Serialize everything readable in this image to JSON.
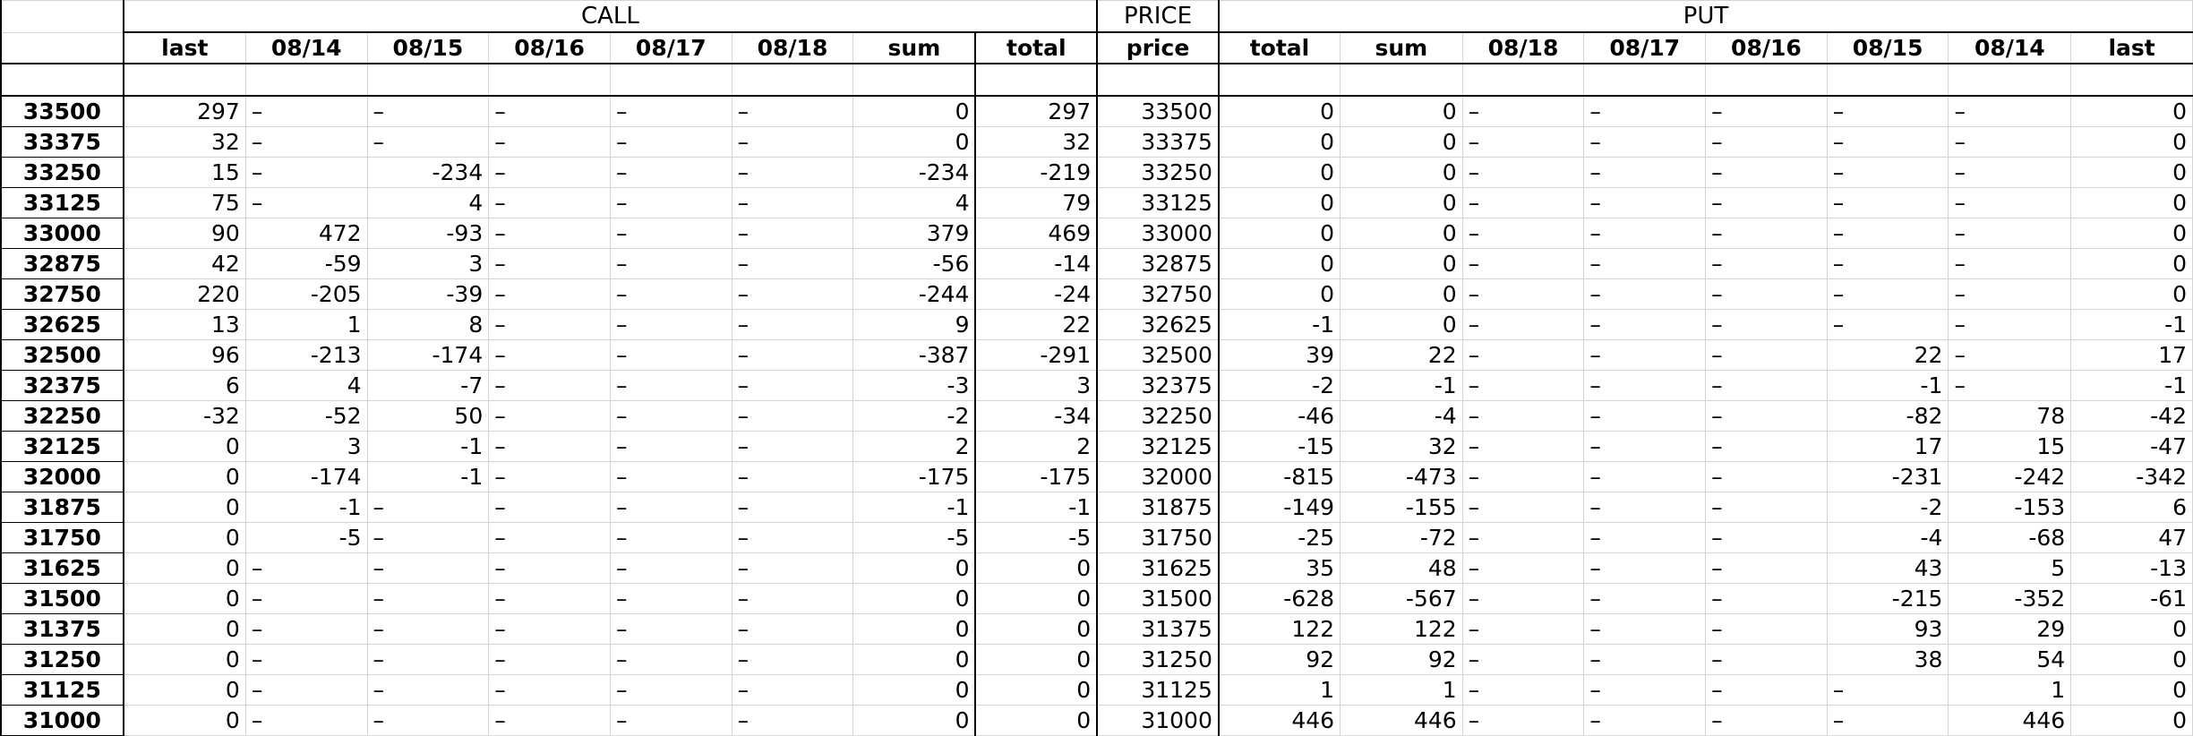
{
  "groups": {
    "call": "CALL",
    "price": "PRICE",
    "put": "PUT"
  },
  "headers": [
    "last",
    "08/14",
    "08/15",
    "08/16",
    "08/17",
    "08/18",
    "sum",
    "total",
    "price",
    "total",
    "sum",
    "08/18",
    "08/17",
    "08/16",
    "08/15",
    "08/14",
    "last"
  ],
  "rows": [
    {
      "label": "33500",
      "cells": [
        "297",
        "–",
        "–",
        "–",
        "–",
        "–",
        "0",
        "297",
        "33500",
        "0",
        "0",
        "–",
        "–",
        "–",
        "–",
        "–",
        "0"
      ]
    },
    {
      "label": "33375",
      "cells": [
        "32",
        "–",
        "–",
        "–",
        "–",
        "–",
        "0",
        "32",
        "33375",
        "0",
        "0",
        "–",
        "–",
        "–",
        "–",
        "–",
        "0"
      ]
    },
    {
      "label": "33250",
      "cells": [
        "15",
        "–",
        "-234",
        "–",
        "–",
        "–",
        "-234",
        "-219",
        "33250",
        "0",
        "0",
        "–",
        "–",
        "–",
        "–",
        "–",
        "0"
      ]
    },
    {
      "label": "33125",
      "cells": [
        "75",
        "–",
        "4",
        "–",
        "–",
        "–",
        "4",
        "79",
        "33125",
        "0",
        "0",
        "–",
        "–",
        "–",
        "–",
        "–",
        "0"
      ]
    },
    {
      "label": "33000",
      "cells": [
        "90",
        "472",
        "-93",
        "–",
        "–",
        "–",
        "379",
        "469",
        "33000",
        "0",
        "0",
        "–",
        "–",
        "–",
        "–",
        "–",
        "0"
      ]
    },
    {
      "label": "32875",
      "cells": [
        "42",
        "-59",
        "3",
        "–",
        "–",
        "–",
        "-56",
        "-14",
        "32875",
        "0",
        "0",
        "–",
        "–",
        "–",
        "–",
        "–",
        "0"
      ]
    },
    {
      "label": "32750",
      "cells": [
        "220",
        "-205",
        "-39",
        "–",
        "–",
        "–",
        "-244",
        "-24",
        "32750",
        "0",
        "0",
        "–",
        "–",
        "–",
        "–",
        "–",
        "0"
      ]
    },
    {
      "label": "32625",
      "cells": [
        "13",
        "1",
        "8",
        "–",
        "–",
        "–",
        "9",
        "22",
        "32625",
        "-1",
        "0",
        "–",
        "–",
        "–",
        "–",
        "–",
        "-1"
      ]
    },
    {
      "label": "32500",
      "cells": [
        "96",
        "-213",
        "-174",
        "–",
        "–",
        "–",
        "-387",
        "-291",
        "32500",
        "39",
        "22",
        "–",
        "–",
        "–",
        "22",
        "–",
        "17"
      ]
    },
    {
      "label": "32375",
      "cells": [
        "6",
        "4",
        "-7",
        "–",
        "–",
        "–",
        "-3",
        "3",
        "32375",
        "-2",
        "-1",
        "–",
        "–",
        "–",
        "-1",
        "–",
        "-1"
      ]
    },
    {
      "label": "32250",
      "cells": [
        "-32",
        "-52",
        "50",
        "–",
        "–",
        "–",
        "-2",
        "-34",
        "32250",
        "-46",
        "-4",
        "–",
        "–",
        "–",
        "-82",
        "78",
        "-42"
      ]
    },
    {
      "label": "32125",
      "cells": [
        "0",
        "3",
        "-1",
        "–",
        "–",
        "–",
        "2",
        "2",
        "32125",
        "-15",
        "32",
        "–",
        "–",
        "–",
        "17",
        "15",
        "-47"
      ]
    },
    {
      "label": "32000",
      "cells": [
        "0",
        "-174",
        "-1",
        "–",
        "–",
        "–",
        "-175",
        "-175",
        "32000",
        "-815",
        "-473",
        "–",
        "–",
        "–",
        "-231",
        "-242",
        "-342"
      ]
    },
    {
      "label": "31875",
      "cells": [
        "0",
        "-1",
        "–",
        "–",
        "–",
        "–",
        "-1",
        "-1",
        "31875",
        "-149",
        "-155",
        "–",
        "–",
        "–",
        "-2",
        "-153",
        "6"
      ]
    },
    {
      "label": "31750",
      "cells": [
        "0",
        "-5",
        "–",
        "–",
        "–",
        "–",
        "-5",
        "-5",
        "31750",
        "-25",
        "-72",
        "–",
        "–",
        "–",
        "-4",
        "-68",
        "47"
      ]
    },
    {
      "label": "31625",
      "cells": [
        "0",
        "–",
        "–",
        "–",
        "–",
        "–",
        "0",
        "0",
        "31625",
        "35",
        "48",
        "–",
        "–",
        "–",
        "43",
        "5",
        "-13"
      ]
    },
    {
      "label": "31500",
      "cells": [
        "0",
        "–",
        "–",
        "–",
        "–",
        "–",
        "0",
        "0",
        "31500",
        "-628",
        "-567",
        "–",
        "–",
        "–",
        "-215",
        "-352",
        "-61"
      ]
    },
    {
      "label": "31375",
      "cells": [
        "0",
        "–",
        "–",
        "–",
        "–",
        "–",
        "0",
        "0",
        "31375",
        "122",
        "122",
        "–",
        "–",
        "–",
        "93",
        "29",
        "0"
      ]
    },
    {
      "label": "31250",
      "cells": [
        "0",
        "–",
        "–",
        "–",
        "–",
        "–",
        "0",
        "0",
        "31250",
        "92",
        "92",
        "–",
        "–",
        "–",
        "38",
        "54",
        "0"
      ]
    },
    {
      "label": "31125",
      "cells": [
        "0",
        "–",
        "–",
        "–",
        "–",
        "–",
        "0",
        "0",
        "31125",
        "1",
        "1",
        "–",
        "–",
        "–",
        "–",
        "1",
        "0"
      ]
    },
    {
      "label": "31000",
      "cells": [
        "0",
        "–",
        "–",
        "–",
        "–",
        "–",
        "0",
        "0",
        "31000",
        "446",
        "446",
        "–",
        "–",
        "–",
        "–",
        "446",
        "0"
      ]
    }
  ]
}
